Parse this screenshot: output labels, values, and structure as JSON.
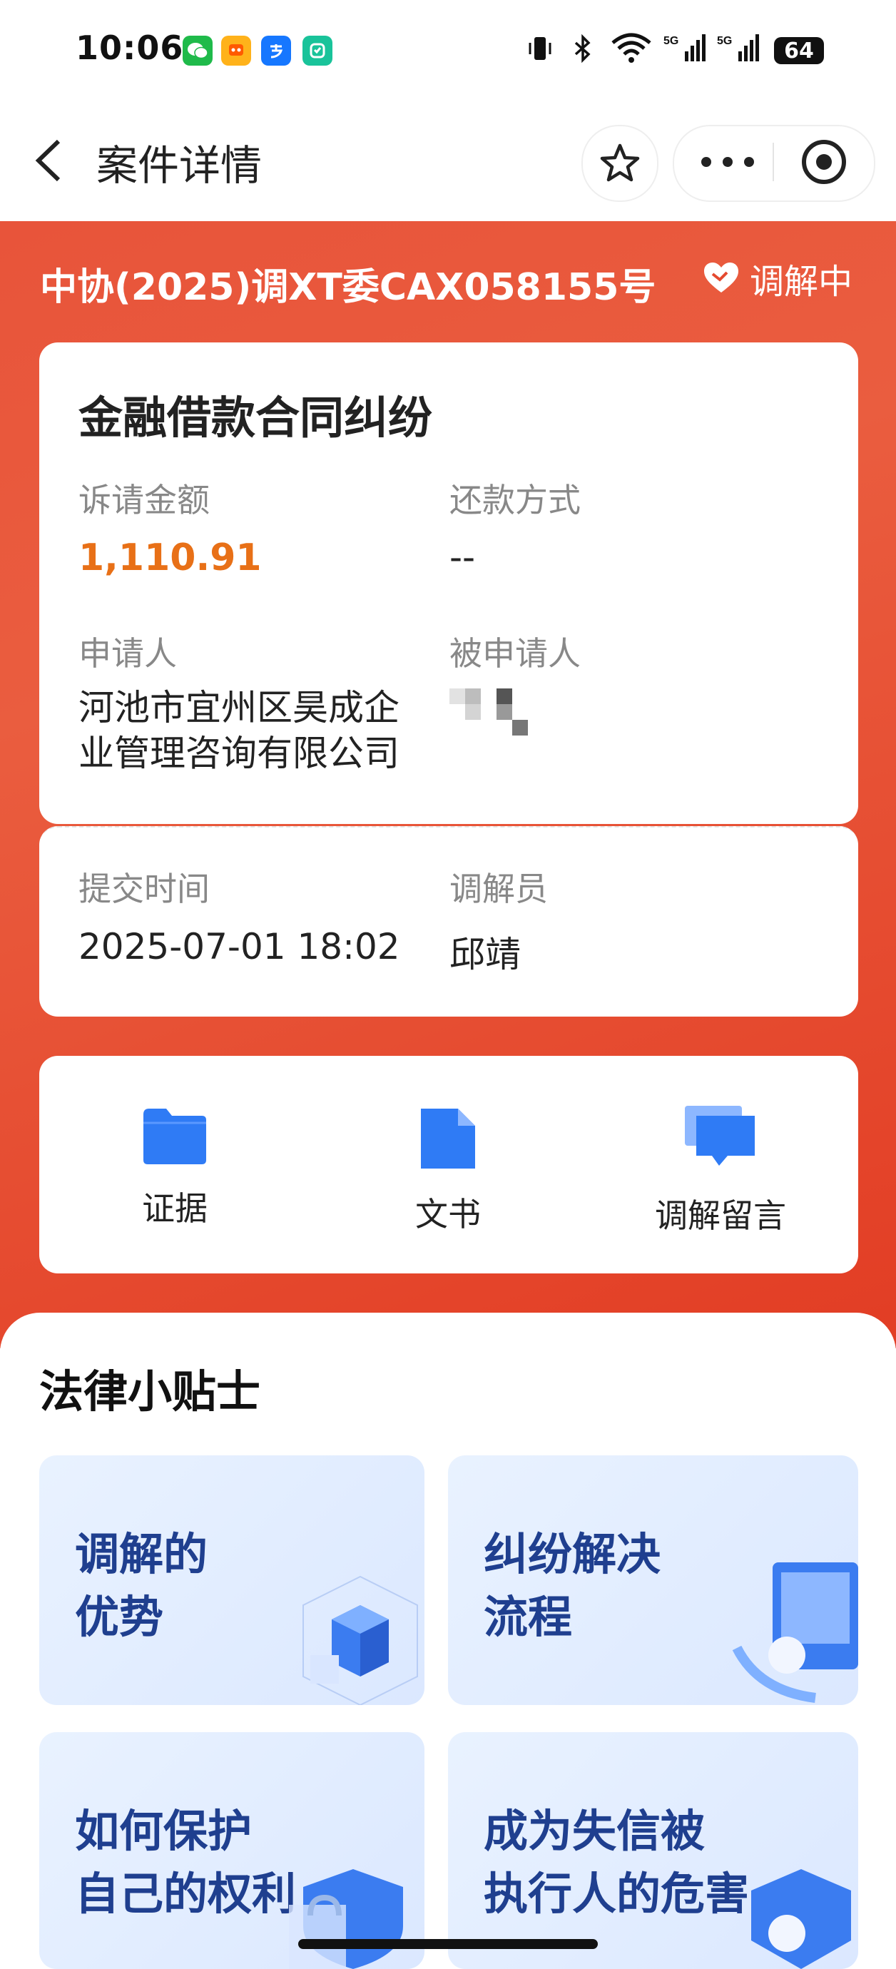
{
  "status_bar": {
    "time": "10:06",
    "battery": "64",
    "app_icons": [
      "wechat-icon",
      "taobao-icon",
      "alipay-icon",
      "app-icon"
    ],
    "colors": {
      "wechat": "#1fba4a",
      "taobao": "#ff7a1a",
      "alipay": "#1677ff",
      "app": "#19c39a"
    }
  },
  "nav": {
    "title": "案件详情",
    "back_icon": "chevron-left-icon",
    "favorite_icon": "star-icon",
    "more_icon": "more-icon",
    "close_icon": "target-icon"
  },
  "header": {
    "case_number": "中协(2025)调XT委CAX058155号",
    "status": "调解中",
    "status_icon": "heart-handshake-icon",
    "accent": "#e5492f"
  },
  "case_card": {
    "title": "金融借款合同纠纷",
    "amount_label": "诉请金额",
    "amount_value": "1,110.91",
    "repay_label": "还款方式",
    "repay_value": "--",
    "applicant_label": "申请人",
    "applicant_value": "河池市宜州区昊成企业管理咨询有限公司",
    "respondent_label": "被申请人",
    "submit_label": "提交时间",
    "submit_value": "2025-07-01 18:02",
    "mediator_label": "调解员",
    "mediator_value": "邱靖",
    "amount_color": "#e87017"
  },
  "functions": [
    {
      "label": "证据",
      "icon": "folder-icon"
    },
    {
      "label": "文书",
      "icon": "document-icon"
    },
    {
      "label": "调解留言",
      "icon": "message-icon"
    }
  ],
  "tips": {
    "title": "法律小贴士",
    "items": [
      {
        "text": "调解的\n优势"
      },
      {
        "text": "纠纷解决\n流程"
      },
      {
        "text": "如何保护\n自己的权利"
      },
      {
        "text": "成为失信被\n执行人的危害"
      }
    ]
  }
}
